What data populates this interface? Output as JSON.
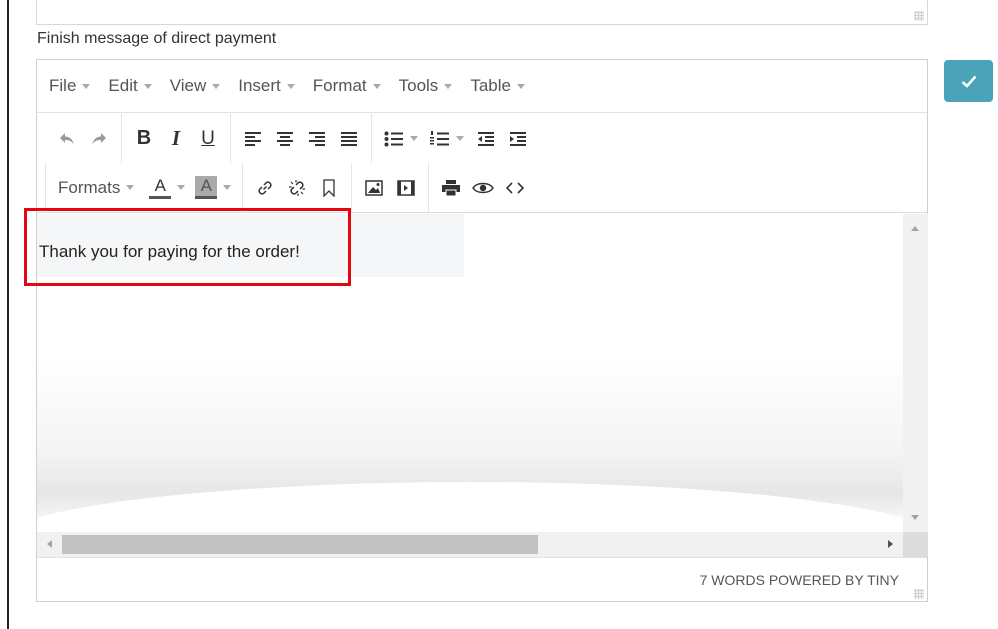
{
  "field_label": "Finish message of direct payment",
  "menubar": {
    "items": [
      {
        "label": "File"
      },
      {
        "label": "Edit"
      },
      {
        "label": "View"
      },
      {
        "label": "Insert"
      },
      {
        "label": "Format"
      },
      {
        "label": "Tools"
      },
      {
        "label": "Table"
      }
    ]
  },
  "toolbar": {
    "bold": "B",
    "italic": "I",
    "underline": "U",
    "formats_label": "Formats",
    "text_color_glyph": "A",
    "bg_color_glyph": "A"
  },
  "content": {
    "text": "Thank you for paying for the order!"
  },
  "statusbar": {
    "text": "7 WORDS POWERED BY TINY"
  },
  "colors": {
    "accent": "#4aa3b8",
    "highlight": "#e30613"
  }
}
